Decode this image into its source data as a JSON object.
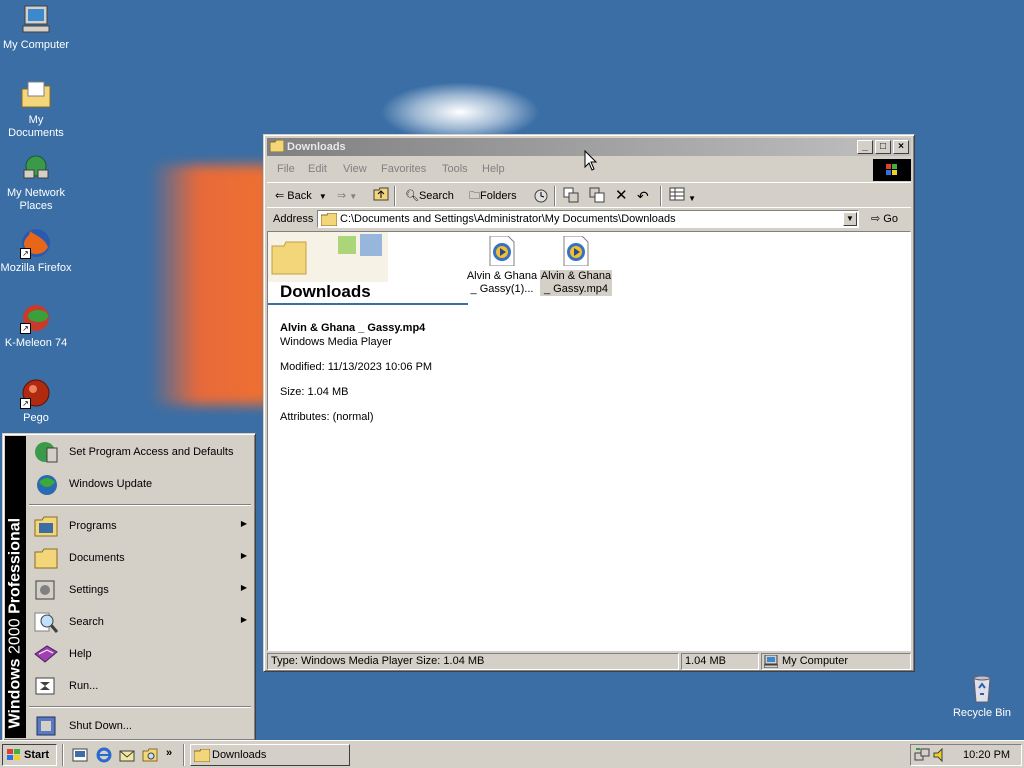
{
  "desktop": {
    "icons": [
      {
        "label": "My Computer"
      },
      {
        "label": "My Documents"
      },
      {
        "label": "My Network Places"
      },
      {
        "label": "Mozilla Firefox"
      },
      {
        "label": "K-Meleon 74"
      },
      {
        "label": "Pego"
      },
      {
        "label": "Recycle Bin"
      }
    ]
  },
  "window": {
    "title": "Downloads",
    "menu": [
      "File",
      "Edit",
      "View",
      "Favorites",
      "Tools",
      "Help"
    ],
    "toolbar": {
      "back": "Back",
      "search": "Search",
      "folders": "Folders"
    },
    "address": {
      "label": "Address",
      "value": "C:\\Documents and Settings\\Administrator\\My Documents\\Downloads",
      "go": "Go"
    },
    "panel": {
      "folder_title": "Downloads",
      "file_name": "Alvin & Ghana _ Gassy.mp4",
      "file_type": "Windows Media Player",
      "modified": "Modified: 11/13/2023 10:06 PM",
      "size": "Size: 1.04 MB",
      "attributes": "Attributes: (normal)"
    },
    "files": [
      {
        "line1": "Alvin & Ghana",
        "line2": "_ Gassy(1)...",
        "selected": false
      },
      {
        "line1": "Alvin & Ghana",
        "line2": "_ Gassy.mp4",
        "selected": true
      }
    ],
    "status": {
      "text": "Type: Windows Media Player Size: 1.04 MB",
      "size": "1.04 MB",
      "zone": "My Computer"
    }
  },
  "start_menu": {
    "banner_bold": "Windows",
    "banner_mid": "2000",
    "banner_end": "Professional",
    "items": [
      {
        "label": "Set Program Access and Defaults",
        "submenu": false
      },
      {
        "label": "Windows Update",
        "submenu": false
      },
      {
        "label": "Programs",
        "submenu": true
      },
      {
        "label": "Documents",
        "submenu": true
      },
      {
        "label": "Settings",
        "submenu": true
      },
      {
        "label": "Search",
        "submenu": true
      },
      {
        "label": "Help",
        "submenu": false
      },
      {
        "label": "Run...",
        "submenu": false
      },
      {
        "label": "Shut Down...",
        "submenu": false
      }
    ]
  },
  "taskbar": {
    "start_label": "Start",
    "task_label": "Downloads",
    "clock": "10:20 PM"
  }
}
